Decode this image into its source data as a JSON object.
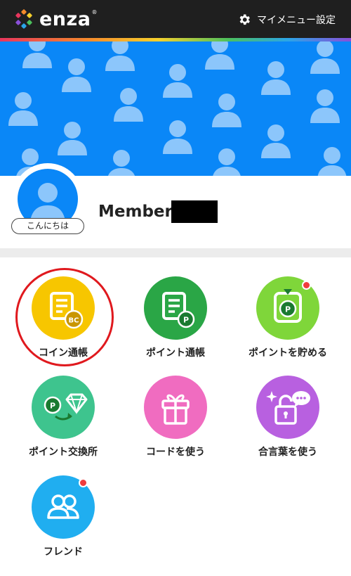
{
  "app": {
    "logo_text": "enza",
    "logo_reg": "®",
    "menu_label": "マイメニュー設定"
  },
  "profile": {
    "greeting": "こんにちは",
    "member_prefix": "Member"
  },
  "menu_items": [
    {
      "label": "コイン通帳",
      "icon": "coin-passbook-icon",
      "color": "#f7c600",
      "notification": false,
      "highlighted": true
    },
    {
      "label": "ポイント通帳",
      "icon": "point-passbook-icon",
      "color": "#2aa646",
      "notification": false,
      "highlighted": false
    },
    {
      "label": "ポイントを貯める",
      "icon": "earn-points-icon",
      "color": "#7fd63a",
      "notification": true,
      "highlighted": false
    },
    {
      "label": "ポイント交換所",
      "icon": "point-exchange-icon",
      "color": "#3ec48e",
      "notification": false,
      "highlighted": false
    },
    {
      "label": "コードを使う",
      "icon": "gift-code-icon",
      "color": "#f06cc0",
      "notification": false,
      "highlighted": false
    },
    {
      "label": "合言葉を使う",
      "icon": "passphrase-lock-icon",
      "color": "#b860e0",
      "notification": false,
      "highlighted": false
    },
    {
      "label": "フレンド",
      "icon": "friends-icon",
      "color": "#20aef0",
      "notification": true,
      "highlighted": false
    }
  ],
  "colors": {
    "header_bg": "#1f1f1f",
    "banner_bg": "#0a87f7",
    "notification_dot": "#f03c3c",
    "highlight_ring": "#e0191e"
  }
}
